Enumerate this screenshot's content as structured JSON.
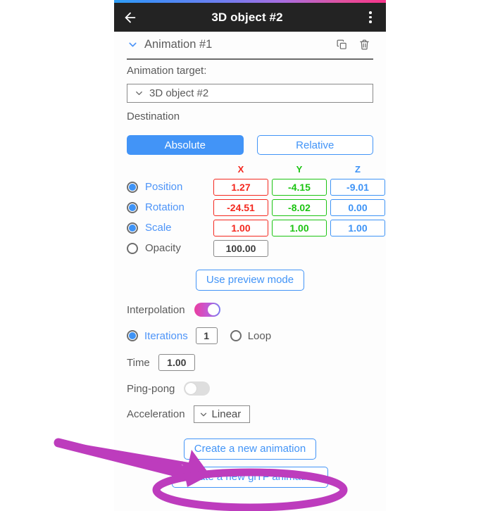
{
  "titlebar": {
    "back_icon": "arrow-left-icon",
    "title": "3D object #2",
    "menu_icon": "kebab-menu-icon"
  },
  "animation_header": {
    "expand_icon": "chevron-down-icon",
    "title": "Animation #1",
    "duplicate_icon": "copy-icon",
    "delete_icon": "trash-icon"
  },
  "target": {
    "label": "Animation target:",
    "selected": "3D object #2",
    "dropdown_icon": "chevron-down-icon"
  },
  "destination": {
    "label": "Destination",
    "absolute_label": "Absolute",
    "relative_label": "Relative",
    "selected": "Absolute"
  },
  "axes": {
    "headers": [
      "X",
      "Y",
      "Z"
    ],
    "colors": {
      "x": "#f4281f",
      "y": "#1cc412",
      "z": "#3e93f6"
    },
    "rows": [
      {
        "name": "Position",
        "selected": true,
        "values": [
          "1.27",
          "-4.15",
          "-9.01"
        ]
      },
      {
        "name": "Rotation",
        "selected": true,
        "values": [
          "-24.51",
          "-8.02",
          "0.00"
        ]
      },
      {
        "name": "Scale",
        "selected": true,
        "values": [
          "1.00",
          "1.00",
          "1.00"
        ]
      }
    ],
    "opacity": {
      "name": "Opacity",
      "selected": false,
      "value": "100.00"
    }
  },
  "preview": {
    "label": "Use preview mode"
  },
  "interpolation": {
    "label": "Interpolation",
    "enabled": true
  },
  "iterations": {
    "label": "Iterations",
    "selected": true,
    "value": "1",
    "loop_label": "Loop",
    "loop_selected": false
  },
  "time": {
    "label": "Time",
    "value": "1.00"
  },
  "pingpong": {
    "label": "Ping-pong",
    "enabled": false
  },
  "acceleration": {
    "label": "Acceleration",
    "selected": "Linear",
    "dropdown_icon": "chevron-down-icon"
  },
  "create_buttons": {
    "animation": "Create a new animation",
    "gltf": "Create a new glTF animation"
  },
  "annotations": {
    "arrow": "arrow-pointer-annotation",
    "highlight": "ellipse-highlight-annotation",
    "color": "#bd3cbd"
  }
}
